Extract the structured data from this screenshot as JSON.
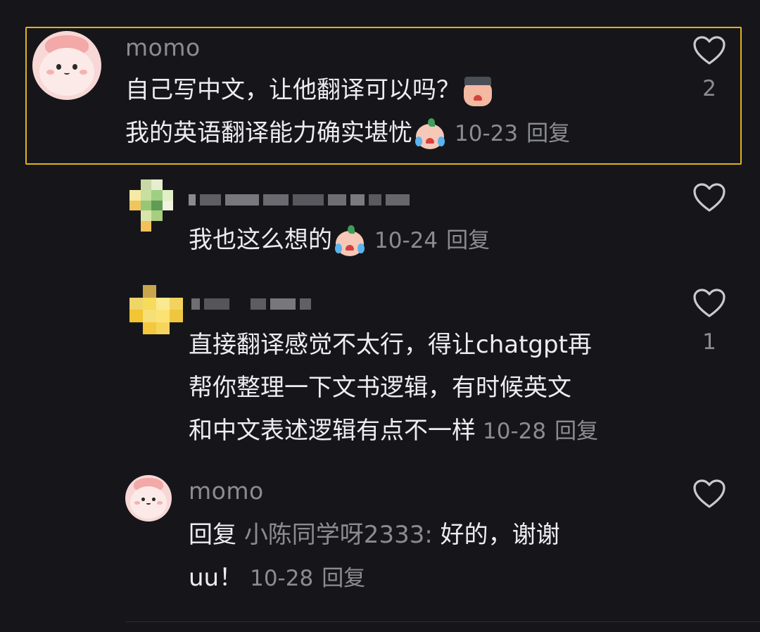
{
  "comments": [
    {
      "username": "momo",
      "lines": [
        "自己写中文，让他翻译可以吗？",
        "我的英语翻译能力确实堪忧"
      ],
      "date": "10-23",
      "reply_label": "回复",
      "likes": "2",
      "highlighted": true
    },
    {
      "username": "",
      "lines": [
        "我也这么想的"
      ],
      "date": "10-24",
      "reply_label": "回复",
      "likes": ""
    },
    {
      "username": "",
      "lines": [
        "直接翻译感觉不太行，得让chatgpt再",
        "帮你整理一下文书逻辑，有时候英文",
        "和中文表述逻辑有点不一样"
      ],
      "date": "10-28",
      "reply_label": "回复",
      "likes": "1"
    },
    {
      "username": "momo",
      "reply_prefix": "回复",
      "mention": "小陈同学呀2333:",
      "lines": [
        "好的，谢谢",
        "uu！"
      ],
      "date": "10-28",
      "reply_label": "回复",
      "likes": ""
    }
  ],
  "icons": {
    "like": "heart-outline-icon",
    "emoji_cry": "crying-peach-emoji",
    "emoji_facepalm": "facepalm-emoji"
  },
  "colors": {
    "background": "#16161a",
    "highlight_border": "#e0b21d",
    "muted_text": "#8b8b93",
    "primary_text": "#ededf0"
  }
}
